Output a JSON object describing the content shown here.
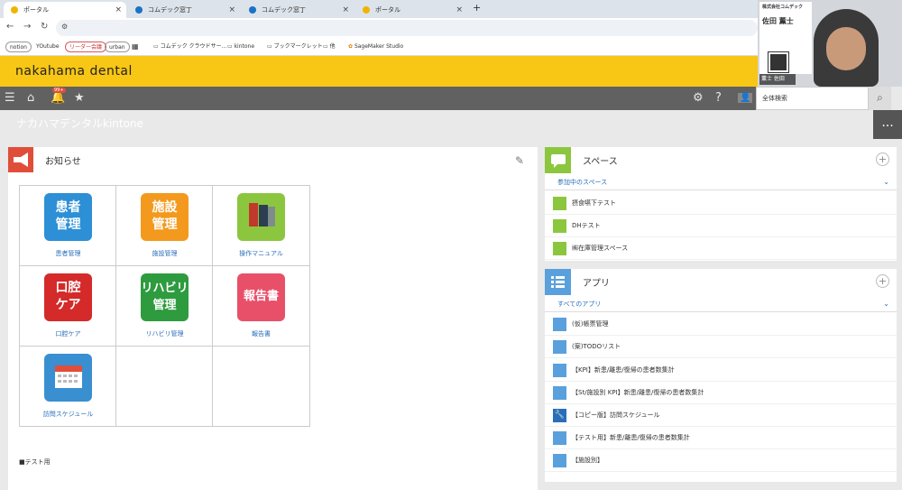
{
  "browser": {
    "tabs": [
      {
        "label": "ポータル",
        "color": "#f0b400"
      },
      {
        "label": "コムデック窓丁",
        "color": "#1a73c8"
      },
      {
        "label": "コムデック窓丁",
        "color": "#1a73c8"
      },
      {
        "label": "ポータル",
        "color": "#f0b400"
      }
    ],
    "new_tab": "+",
    "bookmarks": [
      "notion",
      "YOutube",
      "リーダー会議",
      "urban",
      "コムデック クラウドサー...",
      "kintone",
      "ブックマークレット",
      "他",
      "SageMaker Studio"
    ]
  },
  "webcam": {
    "company": "株式会社コムデック",
    "name": "佐田 薫士",
    "caption": "薫士 佐田"
  },
  "brand": {
    "name": "nakahama dental"
  },
  "toolbar": {
    "notification_badge": "99+",
    "search_placeholder": "全体検索",
    "more_label": "..."
  },
  "page": {
    "title": "ナカハマデンタルkintone"
  },
  "notice": {
    "title": "お知らせ",
    "tiles": [
      {
        "tile_text": "患者\n管理",
        "label": "患者管理",
        "color": "#2d8fd5"
      },
      {
        "tile_text": "施設\n管理",
        "label": "施設管理",
        "color": "#f39a1e"
      },
      {
        "tile_text": "",
        "label": "操作マニュアル",
        "color": "#8cc63f"
      },
      {
        "tile_text": "口腔\nケア",
        "label": "口腔ケア",
        "color": "#d42a2a"
      },
      {
        "tile_text": "リハビリ\n管理",
        "label": "リハビリ管理",
        "color": "#2e9b3f"
      },
      {
        "tile_text": "報告書",
        "label": "報告書",
        "color": "#e8506a"
      },
      {
        "tile_text": "",
        "label": "訪問スケジュール",
        "color": "#3a8fd1"
      }
    ],
    "footer": "■テスト用"
  },
  "spaces": {
    "title": "スペース",
    "subhead": "参加中のスペース",
    "items": [
      "摂食嚥下テスト",
      "DHテスト",
      "㈱在庫管理スペース"
    ],
    "icon_color": "#8cc63f"
  },
  "apps": {
    "title": "アプリ",
    "subhead": "すべてのアプリ",
    "items": [
      "(仮)帳票管理",
      "(案)TODOリスト",
      "【KPI】新患/離患/復帰の患者数集計",
      "【St/施設別 KPI】新患/離患/復帰の患者数集計",
      "【コピー版】訪問スケジュール",
      "【テスト用】新患/離患/復帰の患者数集計",
      "【施設別】"
    ],
    "icon_color": "#5aa0dc"
  }
}
